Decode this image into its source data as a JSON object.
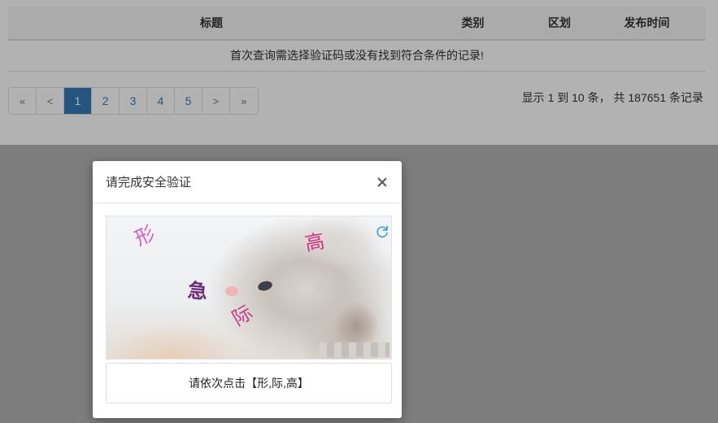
{
  "table": {
    "headers": {
      "title": "标题",
      "category": "类别",
      "region": "区划",
      "publish_time": "发布时间"
    },
    "empty_message": "首次查询需选择验证码或没有找到符合条件的记录!"
  },
  "pagination": {
    "first": "«",
    "prev": "<",
    "pages": [
      "1",
      "2",
      "3",
      "4",
      "5"
    ],
    "active_page": "1",
    "next": ">",
    "last": "»"
  },
  "summary": "显示 1 到 10 条， 共 187651 条记录",
  "modal": {
    "title": "请完成安全验证",
    "captcha_chars": [
      "形",
      "高",
      "急",
      "际"
    ],
    "instruction": "请依次点击【形,际,高】"
  },
  "colors": {
    "accent": "#337ab7"
  }
}
